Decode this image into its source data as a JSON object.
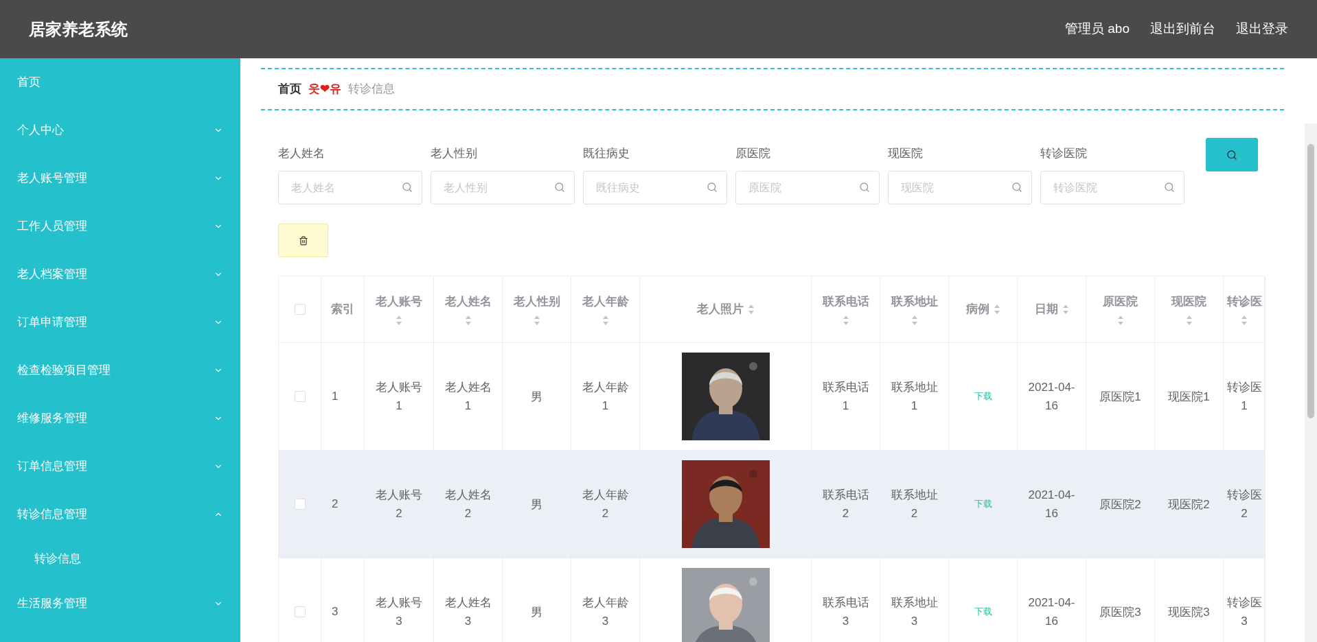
{
  "header": {
    "title": "居家养老系统",
    "user": "管理员 abo",
    "links": [
      "退出到前台",
      "退出登录"
    ]
  },
  "sidebar": {
    "items": [
      {
        "label": "首页",
        "kind": "link"
      },
      {
        "label": "个人中心",
        "kind": "menu",
        "expanded": false
      },
      {
        "label": "老人账号管理",
        "kind": "menu",
        "expanded": false
      },
      {
        "label": "工作人员管理",
        "kind": "menu",
        "expanded": false
      },
      {
        "label": "老人档案管理",
        "kind": "menu",
        "expanded": false
      },
      {
        "label": "订单申请管理",
        "kind": "menu",
        "expanded": false
      },
      {
        "label": "检查检验项目管理",
        "kind": "menu",
        "expanded": false
      },
      {
        "label": "维修服务管理",
        "kind": "menu",
        "expanded": false
      },
      {
        "label": "订单信息管理",
        "kind": "menu",
        "expanded": false
      },
      {
        "label": "转诊信息管理",
        "kind": "menu",
        "expanded": true,
        "children": [
          {
            "label": "转诊信息"
          }
        ]
      },
      {
        "label": "生活服务管理",
        "kind": "menu",
        "expanded": false
      }
    ]
  },
  "breadcrumb": {
    "items": [
      "首页",
      "转诊信息"
    ],
    "separator": "웃❤유"
  },
  "search": {
    "fields": [
      {
        "label": "老人姓名",
        "placeholder": "老人姓名"
      },
      {
        "label": "老人性别",
        "placeholder": "老人性别"
      },
      {
        "label": "既往病史",
        "placeholder": "既往病史"
      },
      {
        "label": "原医院",
        "placeholder": "原医院"
      },
      {
        "label": "现医院",
        "placeholder": "现医院"
      },
      {
        "label": "转诊医院",
        "placeholder": "转诊医院"
      }
    ]
  },
  "table": {
    "select_all": {
      "checked": false
    },
    "columns": [
      {
        "label": "索引",
        "kind": "index"
      },
      {
        "label": "老人账号",
        "kind": "text"
      },
      {
        "label": "老人姓名",
        "kind": "text"
      },
      {
        "label": "老人性别",
        "kind": "text"
      },
      {
        "label": "老人年龄",
        "kind": "text"
      },
      {
        "label": "老人照片",
        "kind": "picture"
      },
      {
        "label": "联系电话",
        "kind": "text"
      },
      {
        "label": "联系地址",
        "kind": "text"
      },
      {
        "label": "病例",
        "kind": "link"
      },
      {
        "label": "日期",
        "kind": "date"
      },
      {
        "label": "原医院",
        "kind": "text"
      },
      {
        "label": "现医院",
        "kind": "text"
      },
      {
        "label": "转诊医",
        "kind": "text"
      }
    ],
    "rows": [
      {
        "checked": false,
        "highlighted": false,
        "cells": [
          "1",
          "老人账号1",
          "老人姓名1",
          "男",
          "老人年龄1",
          null,
          "联系电话1",
          "联系地址1",
          "下载",
          "2021-04-16",
          "原医院1",
          "现医院1",
          "转诊医1"
        ]
      },
      {
        "checked": false,
        "highlighted": true,
        "cells": [
          "2",
          "老人账号2",
          "老人姓名2",
          "男",
          "老人年龄2",
          null,
          "联系电话2",
          "联系地址2",
          "下载",
          "2021-04-16",
          "原医院2",
          "现医院2",
          "转诊医2"
        ]
      },
      {
        "checked": false,
        "highlighted": false,
        "cells": [
          "3",
          "老人账号3",
          "老人姓名3",
          "男",
          "老人年龄3",
          null,
          "联系电话3",
          "联系地址3",
          "下载",
          "2021-04-16",
          "原医院3",
          "现医院3",
          "转诊医3"
        ]
      }
    ]
  }
}
